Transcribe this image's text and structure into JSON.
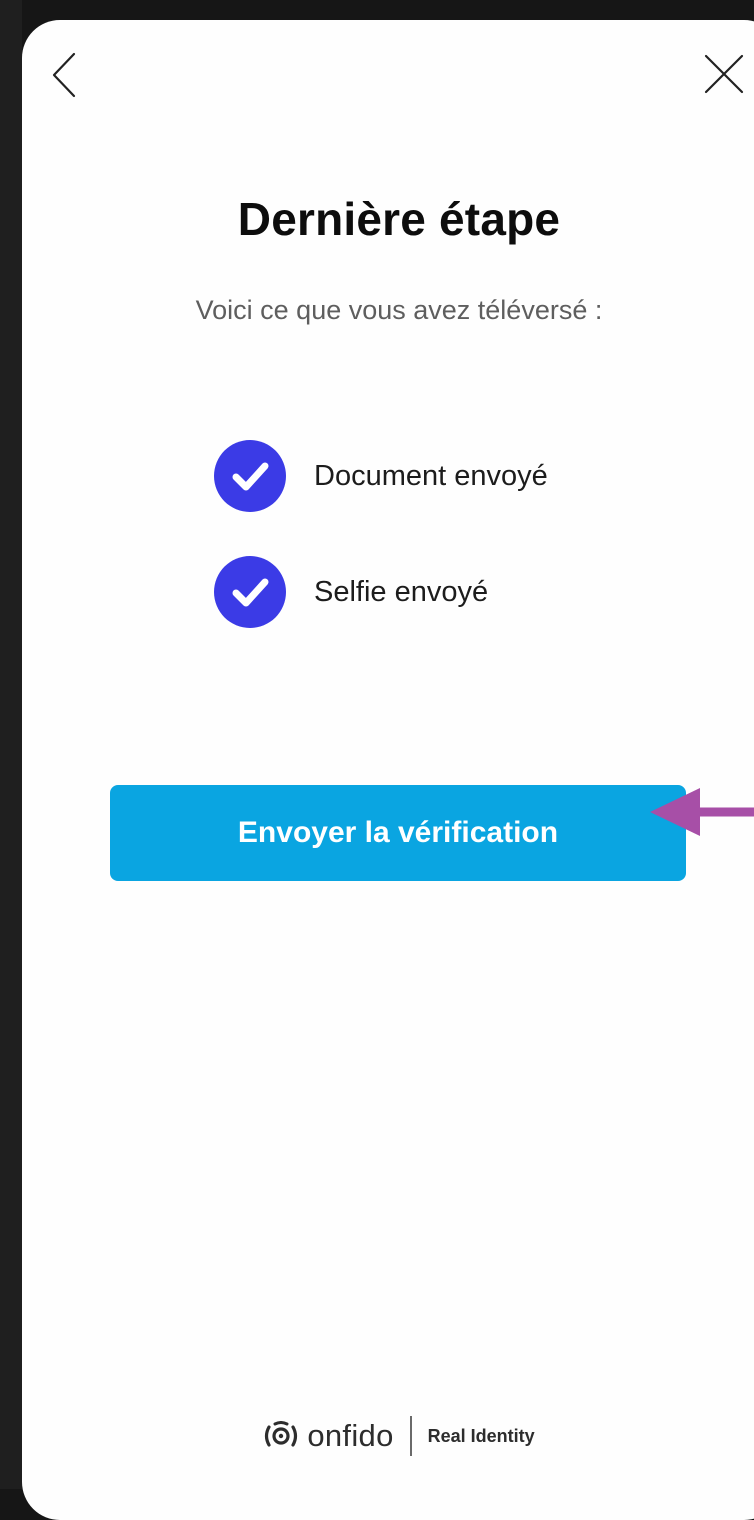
{
  "header": {
    "back_icon": "chevron-left-icon",
    "close_icon": "close-icon"
  },
  "main": {
    "title": "Dernière étape",
    "subtitle": "Voici ce que vous avez téléversé :",
    "items": [
      {
        "label": "Document envoyé",
        "icon": "check-circle-icon"
      },
      {
        "label": "Selfie envoyé",
        "icon": "check-circle-icon"
      }
    ],
    "submit_label": "Envoyer la vérification"
  },
  "annotation": {
    "icon": "arrow-left-icon",
    "color": "#a74fa7"
  },
  "footer": {
    "brand": "onfido",
    "tagline": "Real Identity",
    "brand_icon": "onfido-logo-icon"
  },
  "colors": {
    "check": "#3b3be6",
    "button": "#0aa5e1",
    "background": "#161616"
  }
}
